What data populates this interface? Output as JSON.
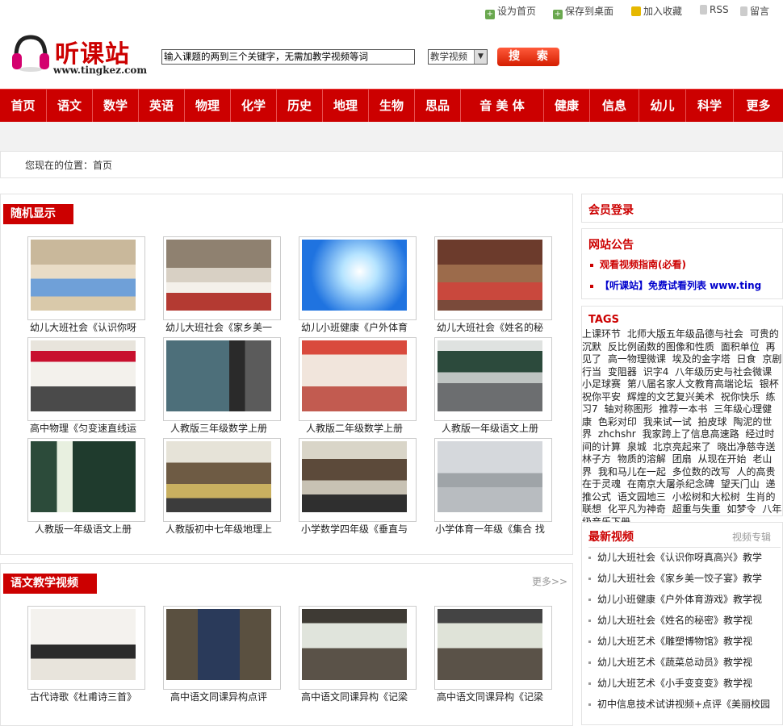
{
  "topbar": {
    "set_home": "设为首页",
    "save_desktop": "保存到桌面",
    "add_favorite": "加入收藏",
    "rss": "RSS",
    "message": "留言"
  },
  "logo": {
    "name": "听课站",
    "url": "www.tingkez.com"
  },
  "search": {
    "placeholder": "输入课题的两到三个关键字，无需加教学视频等词",
    "category": "教学视频",
    "button": "搜 索"
  },
  "nav": [
    "首页",
    "语文",
    "数学",
    "英语",
    "物理",
    "化学",
    "历史",
    "地理",
    "生物",
    "思品",
    "音 美 体",
    "健康",
    "信息",
    "幼儿",
    "科学",
    "更多"
  ],
  "breadcrumb": "您现在的位置：首页",
  "random": {
    "title": "随机显示",
    "items": [
      "幼儿大班社会《认识你呀",
      "幼儿大班社会《家乡美一",
      "幼儿小班健康《户外体育",
      "幼儿大班社会《姓名的秘",
      "高中物理《匀变速直线运",
      "人教版三年级数学上册",
      "人教版二年级数学上册",
      "人教版一年级语文上册",
      "人教版一年级语文上册",
      "人教版初中七年级地理上",
      "小学数学四年级《垂直与",
      "小学体育一年级《集合 找"
    ]
  },
  "chinese": {
    "title": "语文教学视频",
    "more": "更多>>",
    "items": [
      "古代诗歌《杜甫诗三首》",
      "高中语文同课异构点评",
      "高中语文同课异构《记梁",
      "高中语文同课异构《记梁"
    ]
  },
  "login": {
    "title": "会员登录"
  },
  "notice": {
    "title": "网站公告",
    "items": [
      "观看视频指南(必看)",
      "【听课站】免费试看列表 www.ting"
    ]
  },
  "tags": {
    "title": "TAGS",
    "items": [
      "上课环节",
      "北师大版五年级品德与社会",
      "可贵的沉默",
      "反比例函数的图像和性质",
      "面积单位",
      "再见了",
      "高一物理微课",
      "埃及的金字塔",
      "日食",
      "京剧行当",
      "变阻器",
      "识字4",
      "八年级历史与社会微课",
      "小足球赛",
      "第八届名家人文教育高端论坛",
      "银杯",
      "祝你平安",
      "辉煌的文艺复兴美术",
      "祝你快乐",
      "练习7",
      "轴对称图形",
      "推荐一本书",
      "三年级心理健康",
      "色彩对印",
      "我来试一试",
      "拍皮球",
      "陶泥的世界",
      "zhchshr",
      "我家跨上了信息高速路",
      "经过时间的计算",
      "泉城",
      "北京亮起来了",
      "晓出净慈寺送林子方",
      "物质的溶解",
      "团扇",
      "从现在开始",
      "老山界",
      "我和马儿在一起",
      "多位数的改写",
      "人的高贵在于灵魂",
      "在南京大屠杀纪念碑",
      "望天门山",
      "递推公式",
      "语文园地三",
      "小松树和大松树",
      "生肖的联想",
      "化平凡为神奇",
      "超重与失重",
      "如梦令",
      "八年级音乐下册"
    ]
  },
  "latest": {
    "title": "最新视频",
    "more": "视频专辑",
    "items": [
      "幼儿大班社会《认识你呀真高兴》教学",
      "幼儿大班社会《家乡美一饺子宴》教学",
      "幼儿小班健康《户外体育游戏》教学视",
      "幼儿大班社会《姓名的秘密》教学视",
      "幼儿大班艺术《雕塑博物馆》教学视",
      "幼儿大班艺术《蔬菜总动员》教学视",
      "幼儿大班艺术《小手变变变》教学视",
      "初中信息技术试讲视频+点评《美丽校园"
    ]
  },
  "colors": {
    "brand_red": "#cc0000",
    "nav_red": "#cc0000"
  }
}
